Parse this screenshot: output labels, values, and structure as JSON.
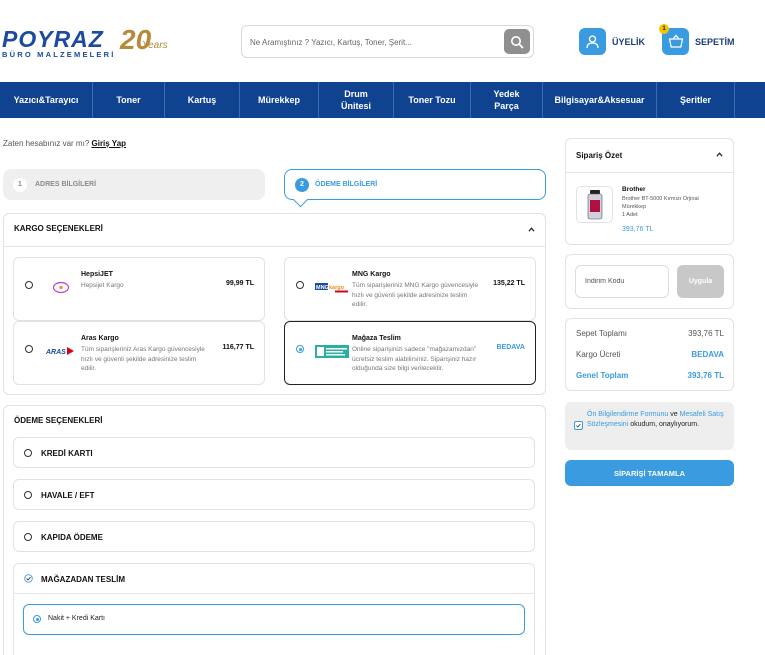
{
  "header": {
    "logo_main": "POYRAZ",
    "logo_sub": "BÜRO MALZEMELERİ",
    "logo_anniversary": "20",
    "logo_years": "Years",
    "search_placeholder": "Ne Aramıştınız ? Yazıcı, Kartuş, Toner, Şerit...",
    "user_label": "ÜYELİK",
    "cart_label": "SEPETİM",
    "cart_count": "1"
  },
  "nav": {
    "items": [
      {
        "label": "Yazıcı&Tarayıcı"
      },
      {
        "label": "Toner"
      },
      {
        "label": "Kartuş"
      },
      {
        "label": "Mürekkep"
      },
      {
        "label": "Drum Ünitesi"
      },
      {
        "label": "Toner Tozu"
      },
      {
        "label": "Yedek Parça"
      },
      {
        "label": "Bilgisayar&Aksesuar"
      },
      {
        "label": "Şeritler"
      }
    ]
  },
  "login_hint": {
    "text": "Zaten hesabınız var mı?",
    "link": "Giriş Yap"
  },
  "steps": [
    {
      "num": "1",
      "label": "ADRES BİLGİLERİ"
    },
    {
      "num": "2",
      "label": "ÖDEME BİLGİLERİ"
    }
  ],
  "kargo": {
    "title": "KARGO SEÇENEKLERİ",
    "options": [
      {
        "logo": "HepsiJET",
        "name": "HepsiJET",
        "desc": "Hepsijet Kargo",
        "price": "99,99 TL"
      },
      {
        "logo": "MNG kargo",
        "name": "MNG Kargo",
        "desc": "Tüm siparişleriniz MNG Kargo güvencesiyle hızlı ve güvenli şekilde adresinize teslim edilir.",
        "price": "135,22 TL"
      },
      {
        "logo": "ARAS",
        "name": "Aras Kargo",
        "desc": "Tüm siparişleriniz Aras Kargo güvencesiyle hızlı ve güvenli şekilde adresinize teslim edilir.",
        "price": "116,77 TL"
      },
      {
        "logo": "Mağaza Teslim",
        "name": "Mağaza Teslim",
        "desc": "Online siparişinizi sadece \"mağazamızdan\" ücretsiz teslim alabilirsiniz. Siparişiniz hazır olduğunda size bilgi verilecektir.",
        "price": "BEDAVA"
      }
    ]
  },
  "odeme": {
    "title": "ÖDEME SEÇENEKLERİ",
    "options": [
      {
        "label": "KREDİ KARTI"
      },
      {
        "label": "HAVALE / EFT"
      },
      {
        "label": "KAPIDA ÖDEME"
      },
      {
        "label": "MAĞAZADAN TESLİM"
      }
    ],
    "sub_option": "Nakit + Kredi Kartı"
  },
  "summary": {
    "title": "Sipariş Özet",
    "product_brand": "Brother",
    "product_name": "Brother BT-5000 Kırmızı Orjinal Mürekkep",
    "product_qty": "1 Adet",
    "product_price": "393,76 TL"
  },
  "coupon": {
    "placeholder": "İndirim Kodu",
    "button": "Uygula"
  },
  "totals": {
    "subtotal_label": "Sepet Toplamı",
    "subtotal_value": "393,76 TL",
    "shipping_label": "Kargo Ücreti",
    "shipping_value": "BEDAVA",
    "grand_label": "Genel Toplam",
    "grand_value": "393,76 TL"
  },
  "agreement": {
    "link1": "Ön Bilgilendirme Formunu",
    "and": " ve ",
    "link2": "Mesafeli Satış Sözleşmesini",
    "rest": " okudum, onaylıyorum."
  },
  "complete_button": "SİPARİŞİ TAMAMLA",
  "colors": {
    "brand_blue": "#0f4390",
    "accent": "#3a9be0",
    "gold": "#b58b3a"
  }
}
